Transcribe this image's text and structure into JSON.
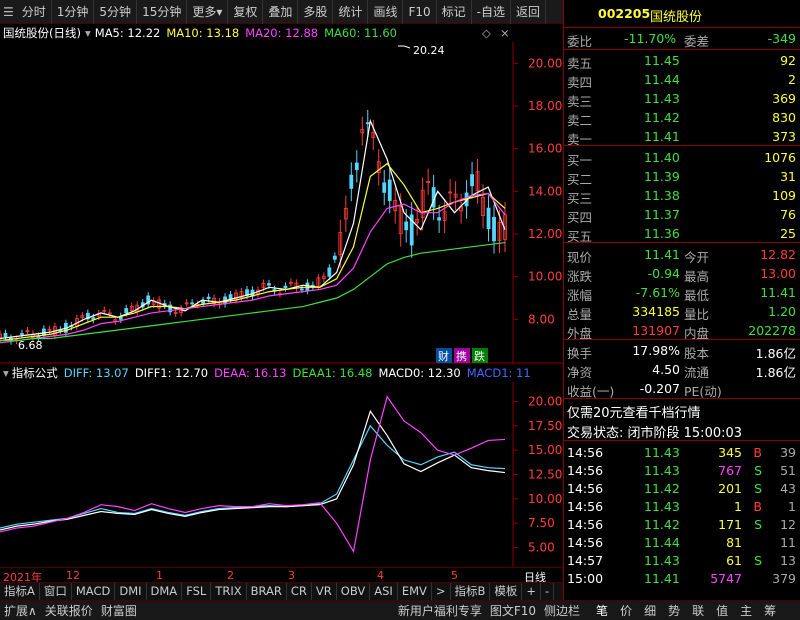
{
  "toolbar": {
    "items": [
      "分时",
      "1分钟",
      "5分钟",
      "15分钟",
      "更多",
      "复权",
      "叠加",
      "多股",
      "统计",
      "画线",
      "F10",
      "标记",
      "-自选",
      "返回"
    ]
  },
  "chart_header": {
    "name": "国统股份(日线)",
    "ma5": "MA5: 12.22",
    "ma10": "MA10: 13.18",
    "ma20": "MA20: 12.88",
    "ma60": "MA60: 11.60"
  },
  "indicator_header": {
    "name": "指标公式",
    "diff": "DIFF: 13.07",
    "diff1": "DIFF1: 12.70",
    "deaa": "DEAA: 16.13",
    "deaa1": "DEAA1: 16.48",
    "macd0": "MACD0: 12.30",
    "macd1": "MACD1: 11"
  },
  "chart_labels": {
    "high_marker": "20.24",
    "low_marker": "6.68",
    "badge_cai": "财",
    "badge_xie": "携",
    "badge_zhang": "跌"
  },
  "price_axis": [
    "20.00",
    "18.00",
    "16.00",
    "14.00",
    "12.00",
    "10.00",
    "8.00"
  ],
  "ind_axis": [
    "20.00",
    "17.50",
    "15.00",
    "12.50",
    "10.00",
    "7.50",
    "5.00"
  ],
  "time_axis": {
    "year": "2021年",
    "labels": [
      "12",
      "1",
      "2",
      "3",
      "4",
      "5"
    ],
    "period": "日线"
  },
  "chart_data": [
    {
      "type": "line",
      "title": "国统股份(日线)",
      "ylim": [
        6,
        21
      ],
      "series": [
        {
          "name": "MA5",
          "color": "#ffffff",
          "values": [
            7.1,
            7.2,
            7.3,
            7.4,
            7.6,
            8.0,
            8.3,
            8.1,
            8.4,
            8.9,
            8.6,
            8.4,
            8.9,
            8.8,
            9.0,
            9.2,
            9.5,
            9.4,
            9.6,
            9.5,
            10.2,
            12.5,
            17.3,
            15.5,
            13.0,
            12.2,
            14.0,
            13.0,
            13.8,
            14.2,
            12.2
          ]
        },
        {
          "name": "MA10",
          "color": "#ffff33",
          "values": [
            7.0,
            7.1,
            7.2,
            7.3,
            7.5,
            7.8,
            8.1,
            8.1,
            8.3,
            8.6,
            8.6,
            8.5,
            8.7,
            8.8,
            8.9,
            9.1,
            9.3,
            9.4,
            9.5,
            9.5,
            9.9,
            11.4,
            14.7,
            15.3,
            14.3,
            13.0,
            13.2,
            13.5,
            13.7,
            13.9,
            13.2
          ]
        },
        {
          "name": "MA20",
          "color": "#ff44ff",
          "values": [
            6.9,
            7.0,
            7.1,
            7.2,
            7.3,
            7.5,
            7.8,
            7.9,
            8.1,
            8.3,
            8.4,
            8.5,
            8.6,
            8.7,
            8.8,
            8.9,
            9.1,
            9.2,
            9.3,
            9.4,
            9.6,
            10.4,
            12.1,
            13.2,
            13.4,
            13.0,
            13.0,
            13.5,
            13.8,
            13.9,
            12.9
          ]
        },
        {
          "name": "MA60",
          "color": "#3ee03e",
          "values": [
            7.0,
            7.0,
            7.1,
            7.1,
            7.2,
            7.3,
            7.4,
            7.5,
            7.6,
            7.7,
            7.8,
            7.9,
            8.0,
            8.1,
            8.2,
            8.3,
            8.4,
            8.5,
            8.6,
            8.8,
            9.0,
            9.4,
            10.0,
            10.6,
            10.9,
            11.1,
            11.2,
            11.3,
            11.4,
            11.5,
            11.6
          ]
        }
      ]
    },
    {
      "type": "line",
      "title": "指标公式",
      "ylim": [
        3,
        22
      ],
      "series": [
        {
          "name": "DIFF",
          "color": "#55d6ff",
          "values": [
            7.0,
            7.4,
            7.6,
            7.8,
            8.0,
            8.5,
            9.0,
            8.6,
            8.5,
            9.0,
            8.6,
            8.3,
            8.7,
            9.0,
            9.1,
            9.2,
            9.3,
            9.2,
            9.3,
            9.5,
            10.5,
            14.0,
            17.5,
            15.5,
            14.0,
            13.5,
            14.3,
            14.8,
            13.5,
            13.2,
            13.1
          ]
        },
        {
          "name": "DIFF1",
          "color": "#ffffff",
          "values": [
            6.8,
            7.2,
            7.4,
            7.7,
            7.9,
            8.3,
            8.7,
            8.5,
            8.4,
            8.9,
            8.5,
            8.2,
            8.6,
            8.9,
            9.0,
            9.1,
            9.2,
            9.2,
            9.3,
            9.4,
            10.0,
            13.5,
            19.0,
            16.5,
            13.6,
            12.8,
            13.7,
            14.5,
            13.2,
            12.9,
            12.7
          ]
        },
        {
          "name": "DEAA",
          "color": "#ff44ff",
          "values": [
            6.6,
            7.0,
            7.2,
            7.6,
            8.0,
            8.6,
            9.4,
            9.2,
            8.8,
            9.5,
            9.0,
            8.6,
            9.0,
            9.3,
            9.2,
            9.2,
            9.5,
            9.3,
            9.4,
            9.6,
            7.5,
            4.6,
            14.0,
            20.5,
            18.0,
            16.8,
            15.0,
            14.5,
            15.2,
            16.0,
            16.1
          ]
        }
      ]
    }
  ],
  "quote": {
    "code": "002205",
    "name": "国统股份",
    "weibi_label": "委比",
    "weibi": "-11.70%",
    "weicha_label": "委差",
    "weicha": "-349",
    "sells": [
      {
        "label": "卖五",
        "price": "11.45",
        "vol": "92"
      },
      {
        "label": "卖四",
        "price": "11.44",
        "vol": "2"
      },
      {
        "label": "卖三",
        "price": "11.43",
        "vol": "369"
      },
      {
        "label": "卖二",
        "price": "11.42",
        "vol": "830"
      },
      {
        "label": "卖一",
        "price": "11.41",
        "vol": "373"
      }
    ],
    "buys": [
      {
        "label": "买一",
        "price": "11.40",
        "vol": "1076"
      },
      {
        "label": "买二",
        "price": "11.39",
        "vol": "31"
      },
      {
        "label": "买三",
        "price": "11.38",
        "vol": "109"
      },
      {
        "label": "买四",
        "price": "11.37",
        "vol": "76"
      },
      {
        "label": "买五",
        "price": "11.36",
        "vol": "25"
      }
    ],
    "stats": [
      {
        "l1": "现价",
        "v1": "11.41",
        "l2": "今开",
        "v2": "12.82"
      },
      {
        "l1": "涨跌",
        "v1": "-0.94",
        "l2": "最高",
        "v2": "13.00"
      },
      {
        "l1": "涨幅",
        "v1": "-7.61%",
        "l2": "最低",
        "v2": "11.41"
      },
      {
        "l1": "总量",
        "v1": "334185",
        "l2": "量比",
        "v2": "1.20"
      },
      {
        "l1": "外盘",
        "v1": "131907",
        "l2": "内盘",
        "v2": "202278"
      }
    ],
    "stats2": [
      {
        "l1": "换手",
        "v1": "17.98%",
        "l2": "股本",
        "v2": "1.86亿"
      },
      {
        "l1": "净资",
        "v1": "4.50",
        "l2": "流通",
        "v2": "1.86亿"
      },
      {
        "l1": "收益(一)",
        "v1": "-0.207",
        "l2": "PE(动)",
        "v2": ""
      }
    ],
    "promo": "仅需20元查看千档行情",
    "trade_state": "交易状态: 闭市阶段 15:00:03",
    "ticks": [
      {
        "t": "14:56",
        "p": "11.43",
        "v": "345",
        "d": "B",
        "n": "39"
      },
      {
        "t": "14:56",
        "p": "11.43",
        "v": "767",
        "d": "S",
        "n": "51"
      },
      {
        "t": "14:56",
        "p": "11.42",
        "v": "201",
        "d": "S",
        "n": "43"
      },
      {
        "t": "14:56",
        "p": "11.43",
        "v": "1",
        "d": "B",
        "n": "1"
      },
      {
        "t": "14:56",
        "p": "11.42",
        "v": "171",
        "d": "S",
        "n": "12"
      },
      {
        "t": "14:56",
        "p": "11.44",
        "v": "81",
        "d": "",
        "n": "11"
      },
      {
        "t": "14:57",
        "p": "11.43",
        "v": "61",
        "d": "S",
        "n": "13"
      },
      {
        "t": "15:00",
        "p": "11.41",
        "v": "5747",
        "d": "",
        "n": "379"
      }
    ]
  },
  "indicator_tabs": [
    "指标A",
    "窗口",
    "MACD",
    "DMI",
    "DMA",
    "FSL",
    "TRIX",
    "BRAR",
    "CR",
    "VR",
    "OBV",
    "ASI",
    "EMV",
    ">",
    "指标B",
    "模板",
    "+",
    "-"
  ],
  "status": {
    "left": [
      "扩展∧",
      "关联报价",
      "财富圈"
    ],
    "middle": [
      "新用户福利专享",
      "图文F10",
      "侧边栏"
    ],
    "right": [
      "笔",
      "价",
      "细",
      "势",
      "联",
      "值",
      "主",
      "筹"
    ]
  }
}
